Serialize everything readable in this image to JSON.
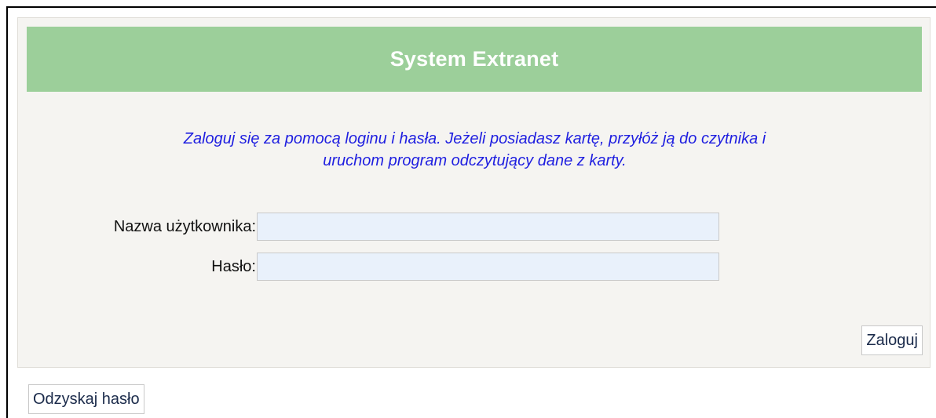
{
  "header": {
    "title": "System Extranet"
  },
  "info": {
    "line1": "Zaloguj się za pomocą loginu i hasła. Jeżeli posiadasz kartę, przyłóż ją do czytnika i",
    "line2": "uruchom program odczytujący dane z karty."
  },
  "form": {
    "username_label": "Nazwa użytkownika:",
    "username_value": "",
    "password_label": "Hasło:",
    "password_value": ""
  },
  "buttons": {
    "login_label": "Zaloguj",
    "recover_label": "Odzyskaj hasło"
  },
  "colors": {
    "header_bg": "#9ccf9a",
    "info_text": "#1f1fe0",
    "input_bg": "#e9f1fb",
    "panel_bg": "#f5f4f1"
  }
}
